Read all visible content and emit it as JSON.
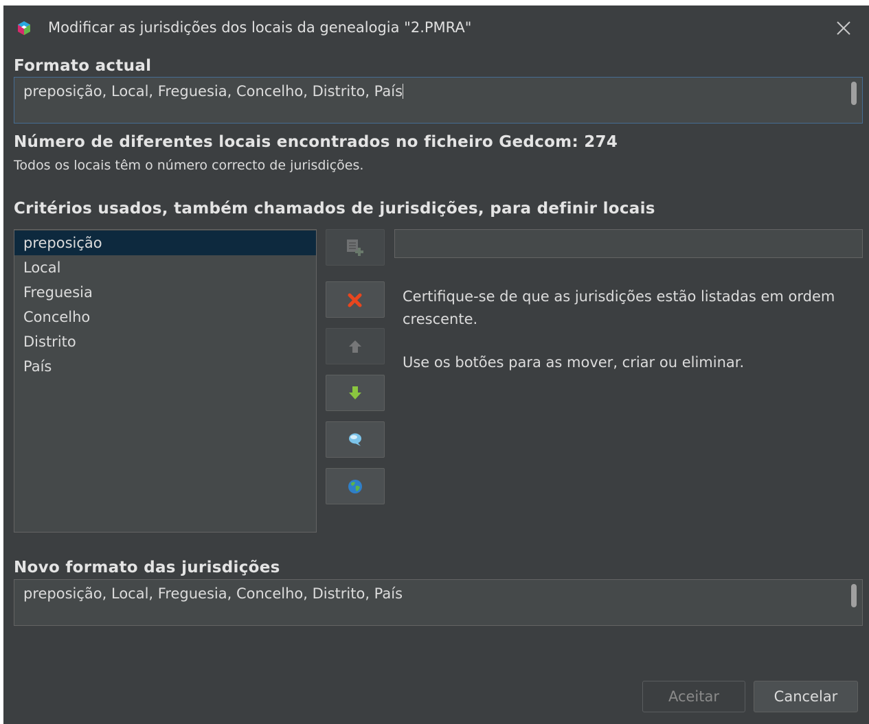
{
  "window": {
    "title": "Modificar as jurisdições dos locais da genealogia \"2.PMRA\""
  },
  "current_format": {
    "label": "Formato actual",
    "value": "preposição, Local, Freguesia, Concelho, Distrito, País"
  },
  "places_found": {
    "label": "Número de diferentes locais encontrados no ficheiro Gedcom: 274",
    "status": "Todos os locais têm o número correcto de jurisdições."
  },
  "criteria": {
    "label": "Critérios usados, também chamados de jurisdições, para definir locais",
    "items": [
      "preposição",
      "Local",
      "Freguesia",
      "Concelho",
      "Distrito",
      "País"
    ],
    "selected_index": 0,
    "input_value": ""
  },
  "toolbar": {
    "icons": [
      "add-icon",
      "delete-icon",
      "arrow-up-icon",
      "arrow-down-icon",
      "speech-bubble-icon",
      "globe-icon"
    ]
  },
  "help": {
    "line1": "Certifique-se de que as jurisdições estão listadas em ordem crescente.",
    "line2": "Use os botões para as mover, criar ou eliminar."
  },
  "new_format": {
    "label": "Novo formato das jurisdições",
    "value": "preposição, Local, Freguesia, Concelho, Distrito, País"
  },
  "buttons": {
    "accept": "Aceitar",
    "cancel": "Cancelar"
  },
  "colors": {
    "background": "#3c3f41",
    "selection": "#0d293e",
    "delete": "#e8461e",
    "arrow_down": "#8bc63f"
  }
}
